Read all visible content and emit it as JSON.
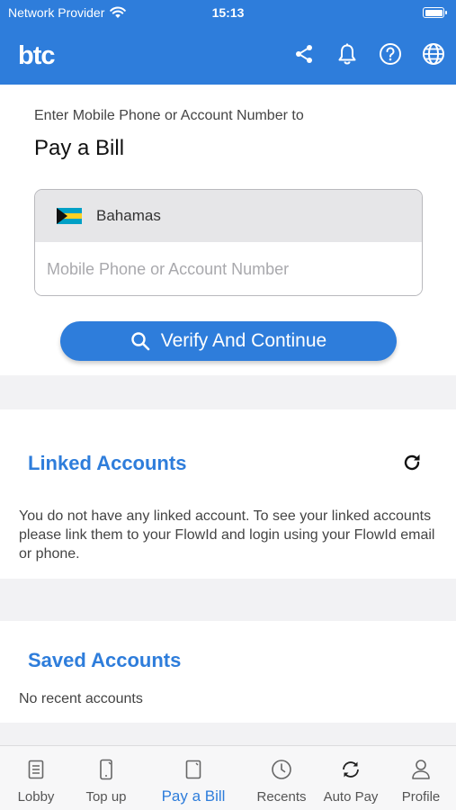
{
  "status_bar": {
    "carrier": "Network Provider",
    "time": "15:13"
  },
  "header": {
    "logo_text": "btc",
    "actions": [
      "share-icon",
      "bell-icon",
      "help-icon",
      "globe-icon"
    ]
  },
  "pay": {
    "subtitle": "Enter Mobile Phone or Account Number to",
    "title": "Pay a Bill",
    "country": "Bahamas",
    "account_placeholder": "Mobile Phone or Account Number",
    "account_value": "",
    "verify_label": "Verify And Continue"
  },
  "linked": {
    "title": "Linked Accounts",
    "text": "You do not have any linked account. To see your linked accounts please link them to your FlowId and login using your FlowId email or phone."
  },
  "saved": {
    "title": "Saved Accounts",
    "text": "No recent accounts"
  },
  "tabs": [
    {
      "label": "Lobby",
      "icon": "document-icon"
    },
    {
      "label": "Top up",
      "icon": "phone-icon"
    },
    {
      "label": "Pay a Bill",
      "icon": "bill-icon",
      "active": true
    },
    {
      "label": "Recents",
      "icon": "clock-icon"
    },
    {
      "label": "Auto Pay",
      "icon": "refresh-icon"
    },
    {
      "label": "Profile",
      "icon": "person-icon"
    }
  ],
  "colors": {
    "brand": "#2e7ddb",
    "background": "#f2f2f4",
    "input_country_bg": "#e6e6e8"
  }
}
